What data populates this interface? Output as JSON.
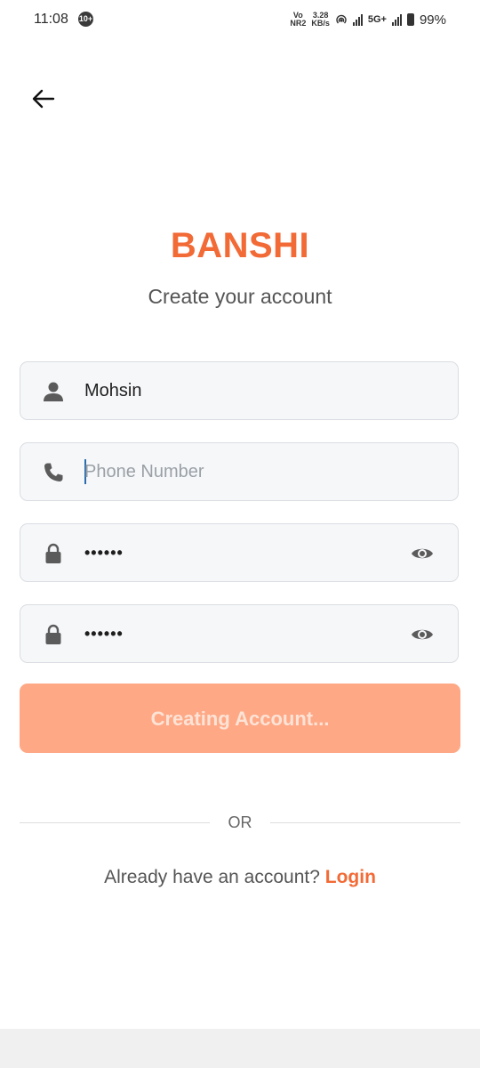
{
  "status_bar": {
    "time": "11:08",
    "notification_count": "10+",
    "volte": "Vo\nNR2",
    "speed": "3.28\nKB/s",
    "network": "5G+",
    "battery": "99%"
  },
  "brand": {
    "title": "BANSHI",
    "subtitle": "Create your account",
    "accent_color": "#f26a36"
  },
  "form": {
    "name": {
      "value": "Mohsin",
      "icon": "person-icon"
    },
    "phone": {
      "value": "",
      "placeholder": "Phone Number",
      "icon": "phone-icon"
    },
    "password": {
      "value": "••••••",
      "icon": "lock-icon",
      "toggle_icon": "eye-icon"
    },
    "confirm_password": {
      "value": "••••••",
      "icon": "lock-icon",
      "toggle_icon": "eye-icon"
    },
    "submit_label": "Creating Account..."
  },
  "divider_text": "OR",
  "footer": {
    "prompt": "Already have an account?",
    "login_label": "Login"
  }
}
